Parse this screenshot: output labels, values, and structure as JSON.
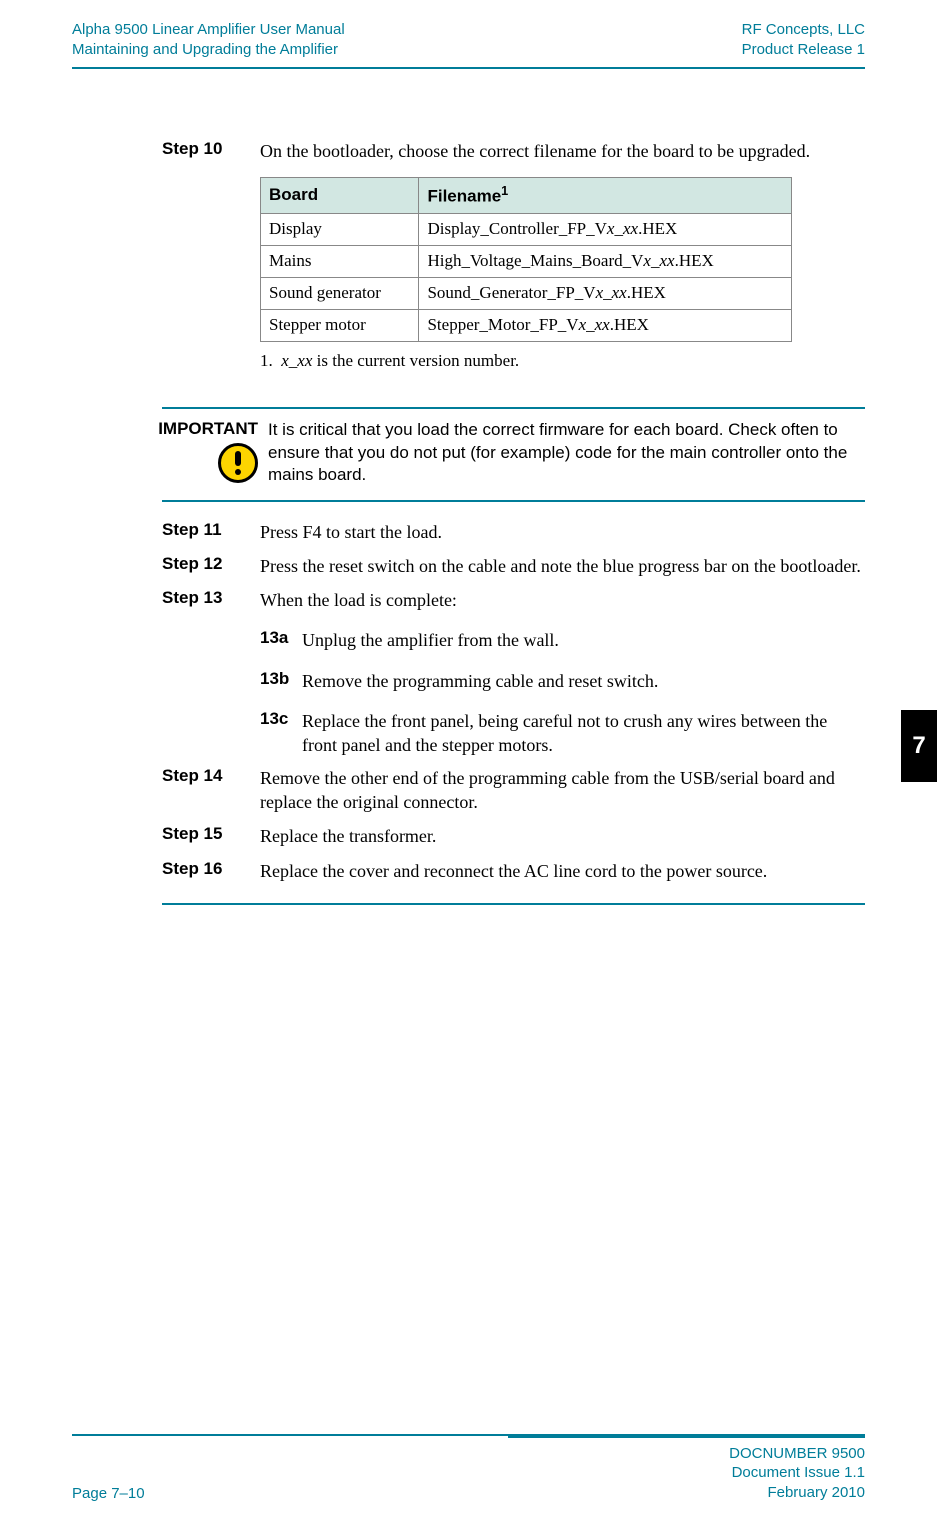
{
  "header": {
    "left_line1": "Alpha 9500 Linear Amplifier User Manual",
    "left_line2": "Maintaining and Upgrading the Amplifier",
    "right_line1": "RF Concepts, LLC",
    "right_line2": "Product Release 1"
  },
  "chapter_tab": "7",
  "step10": {
    "label": "Step 10",
    "text": "On the bootloader, choose the correct filename for the board to be upgraded."
  },
  "table": {
    "head_board": "Board",
    "head_filename": "Filename",
    "head_filename_sup": "1",
    "rows": [
      {
        "board": "Display",
        "prefix": "Display_Controller_FP_V",
        "italic": "x_xx",
        "suffix": ".HEX"
      },
      {
        "board": "Mains",
        "prefix": "High_Voltage_Mains_Board_V",
        "italic": "x_xx",
        "suffix": ".HEX"
      },
      {
        "board": "Sound generator",
        "prefix": "Sound_Generator_FP_V",
        "italic": "x_xx",
        "suffix": ".HEX"
      },
      {
        "board": "Stepper motor",
        "prefix": "Stepper_Motor_FP_V",
        "italic": "x_xx",
        "suffix": ".HEX"
      }
    ],
    "footnote_num": "1.",
    "footnote_italic": "x_xx",
    "footnote_rest": " is the current version number."
  },
  "important": {
    "label": "IMPORTANT",
    "text": "It is critical that you load the correct firmware for each board. Check often to ensure that you do not put (for example) code for the main controller onto the mains board."
  },
  "step11": {
    "label": "Step 11",
    "text": "Press F4 to start the load."
  },
  "step12": {
    "label": "Step 12",
    "text": "Press the reset switch on the cable and note the blue progress bar on the bootloader."
  },
  "step13": {
    "label": "Step 13",
    "text": "When the load is complete:"
  },
  "sub13a": {
    "label": "13a",
    "text": "Unplug the amplifier from the wall."
  },
  "sub13b": {
    "label": "13b",
    "text": "Remove the programming cable and reset switch."
  },
  "sub13c": {
    "label": "13c",
    "text": "Replace the front panel, being careful not to crush any wires between the front panel and the stepper motors."
  },
  "step14": {
    "label": "Step 14",
    "text": "Remove the other end of the programming cable from the USB/serial board and replace the original connector."
  },
  "step15": {
    "label": "Step 15",
    "text": "Replace the transformer."
  },
  "step16": {
    "label": "Step 16",
    "text": "Replace the cover and reconnect the AC line cord to the power source."
  },
  "footer": {
    "page": "Page 7–10",
    "doc1": "DOCNUMBER 9500",
    "doc2": "Document Issue 1.1",
    "doc3": "February 2010"
  }
}
